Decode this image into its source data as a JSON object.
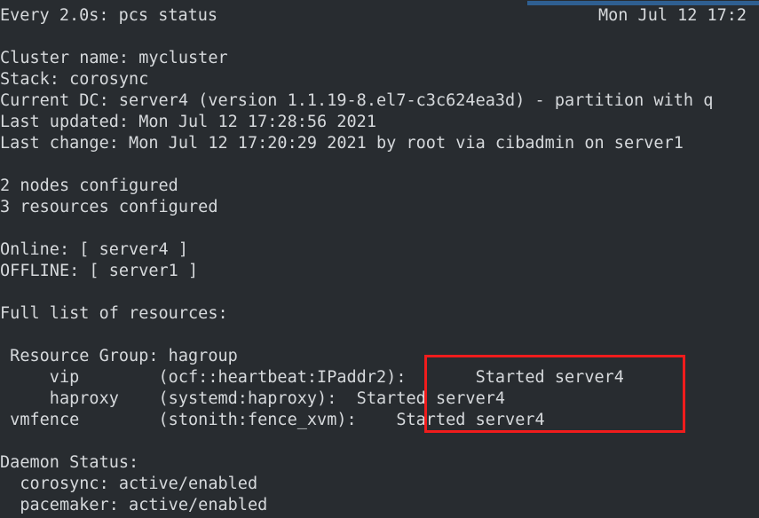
{
  "terminal": {
    "background_color": "#282c30",
    "text_color": "#d6d9dc",
    "accent_blue": "#2f5f91",
    "highlight_color": "#f01c1c"
  },
  "watch_header": {
    "command_label": "Every 2.0s: pcs status",
    "timestamp": "Mon Jul 12 17:2"
  },
  "output": {
    "blank": "",
    "cluster_name": "Cluster name: mycluster",
    "stack": "Stack: corosync",
    "current_dc": "Current DC: server4 (version 1.1.19-8.el7-c3c624ea3d) - partition with q",
    "last_updated": "Last updated: Mon Jul 12 17:28:56 2021",
    "last_change": "Last change: Mon Jul 12 17:20:29 2021 by root via cibadmin on server1",
    "nodes_configured": "2 nodes configured",
    "resources_configured": "3 resources configured",
    "online_nodes": "Online: [ server4 ]",
    "offline_nodes": "OFFLINE: [ server1 ]",
    "full_list_heading": "Full list of resources:",
    "resource_group": " Resource Group: hagroup",
    "resource_vip": "     vip        (ocf::heartbeat:IPaddr2):       Started server4",
    "resource_haproxy": "     haproxy    (systemd:haproxy):  Started server4",
    "resource_vmfence": " vmfence        (stonith:fence_xvm):    Started server4",
    "daemon_status_heading": "Daemon Status:",
    "daemon_corosync": "  corosync: active/enabled",
    "daemon_pacemaker": "  pacemaker: active/enabled"
  }
}
